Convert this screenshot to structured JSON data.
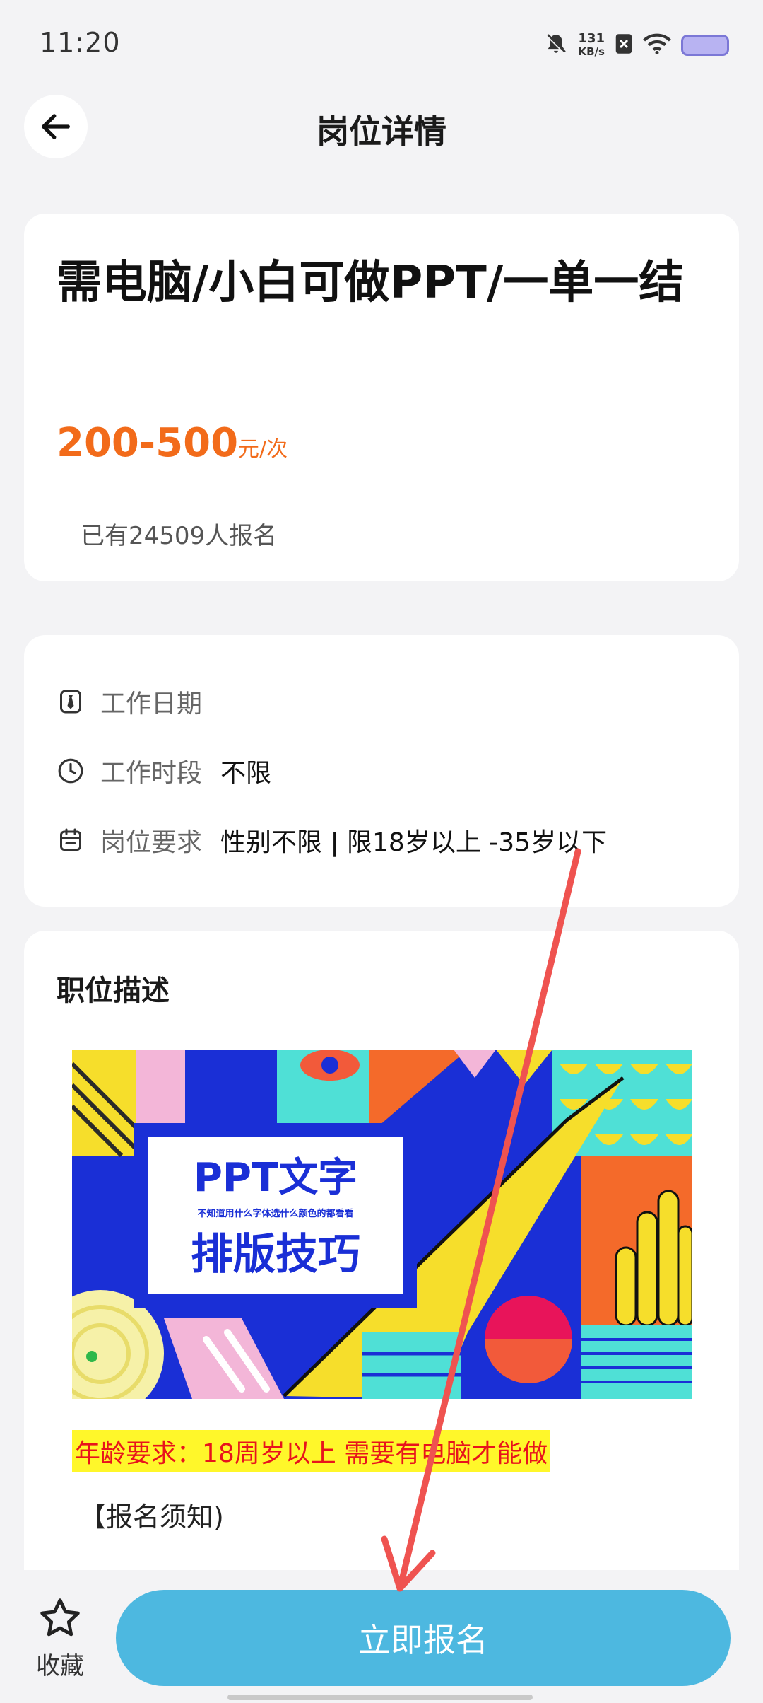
{
  "status_bar": {
    "time": "11:20",
    "speed_value": "131",
    "speed_unit": "KB/s",
    "icons": [
      "bell-off-icon",
      "sim-x-icon",
      "wifi-icon",
      "battery-icon"
    ]
  },
  "header": {
    "title": "岗位详情",
    "back_icon": "arrow-left-icon"
  },
  "job": {
    "title": "需电脑/小白可做PPT/一单一结",
    "salary_range": "200-500",
    "salary_unit": "元/次",
    "applicants_text": "已有24509人报名"
  },
  "details": {
    "rows": [
      {
        "icon": "tie-icon",
        "label": "工作日期",
        "value": ""
      },
      {
        "icon": "clock-icon",
        "label": "工作时段",
        "value": "不限"
      },
      {
        "icon": "calendar-icon",
        "label": "岗位要求",
        "value": "性别不限 | 限18岁以上 -35岁以下"
      }
    ]
  },
  "description": {
    "section_title": "职位描述",
    "banner": {
      "title_line1": "PPT文字",
      "subtitle": "不知道用什么字体选什么颜色的都看看",
      "title_line2": "排版技巧"
    },
    "age_requirement": "年龄要求：18周岁以上 需要有电脑才能做",
    "notice_heading": "【报名须知)"
  },
  "bottom_bar": {
    "favorite_label": "收藏",
    "favorite_icon": "star-icon",
    "apply_label": "立即报名"
  },
  "colors": {
    "accent_orange": "#f26b1a",
    "apply_blue": "#4db8e0",
    "highlight_yellow": "#fff72a",
    "highlight_red": "#e8141c",
    "annotation_arrow": "#ef5350"
  }
}
